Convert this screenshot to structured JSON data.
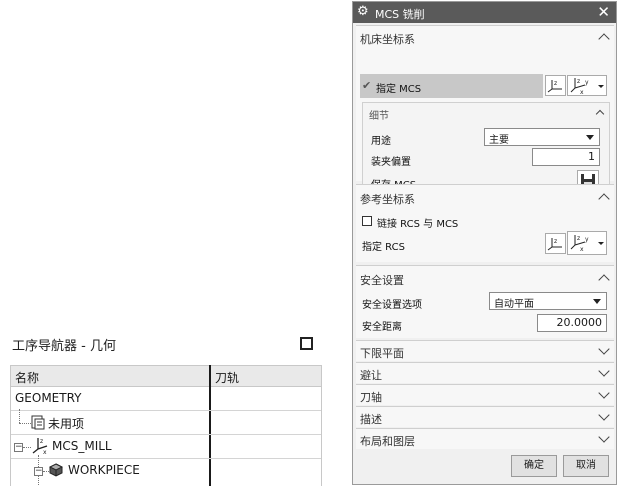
{
  "navigator": {
    "title": "工序导航器 - 几何",
    "columns": [
      "名称",
      "刀轨"
    ],
    "rows": [
      {
        "label": "GEOMETRY"
      },
      {
        "label": "未用项"
      },
      {
        "label": "MCS_MILL"
      },
      {
        "label": "WORKPIECE"
      }
    ]
  },
  "dialog": {
    "title": "MCS 铣削",
    "sections": {
      "machine_csys": {
        "header": "机床坐标系",
        "specify_label": "指定 MCS",
        "details": {
          "header": "细节",
          "purpose_label": "用途",
          "purpose_value": "主要",
          "fixture_offset_label": "装夹偏置",
          "fixture_offset_value": "1",
          "save_label": "保存 MCS"
        }
      },
      "reference_csys": {
        "header": "参考坐标系",
        "link_label": "链接 RCS 与 MCS",
        "specify_label": "指定 RCS"
      },
      "clearance": {
        "header": "安全设置",
        "option_label": "安全设置选项",
        "option_value": "自动平面",
        "distance_label": "安全距离",
        "distance_value": "20.0000"
      }
    },
    "collapsed": [
      "下限平面",
      "避让",
      "刀轴",
      "描述",
      "布局和图层"
    ],
    "ok_label": "确定",
    "cancel_label": "取消"
  }
}
